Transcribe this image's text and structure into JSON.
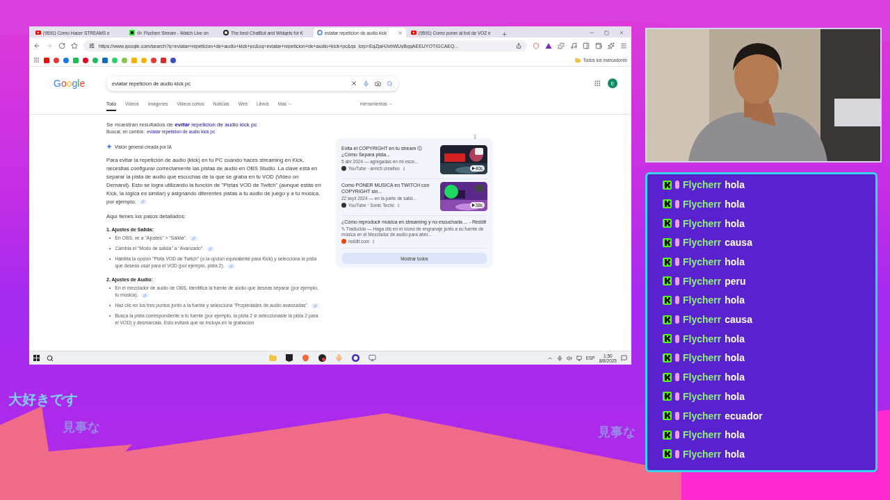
{
  "browser": {
    "tabs": [
      {
        "label": "(9591) Cómo Hacer STREAMS e",
        "kind": "youtube",
        "audio": false,
        "selected": false
      },
      {
        "label": "Flycherr Stream - Watch Live on",
        "kind": "kick",
        "audio": true,
        "selected": false
      },
      {
        "label": "The best ChatBot and Widgets for K",
        "kind": "bot",
        "audio": false,
        "selected": false
      },
      {
        "label": "eviatar repeticion de audio kick",
        "kind": "google",
        "audio": false,
        "selected": true
      },
      {
        "label": "(9591) Como poner al bot de VOZ e",
        "kind": "youtube",
        "audio": false,
        "selected": false
      }
    ],
    "address": "https://www.google.com/search?q=eviatar+repeticion+de+audio+kick+pc&oq=eviatar+repeticion+de+audio+kick+pc&gs_lcrp=EgZjaHJvbWUyBggAEEUYOTIGCAEQ...",
    "bookmarks_folder": "Todos los marcadores",
    "page": {
      "logo": "Google",
      "search": {
        "value": "eviatar repeticion de audio kick pc"
      },
      "avatar": "E",
      "filters": [
        {
          "label": "Todo",
          "selected": true
        },
        {
          "label": "Videos",
          "selected": false
        },
        {
          "label": "Imágenes",
          "selected": false
        },
        {
          "label": "Videos cortos",
          "selected": false
        },
        {
          "label": "Noticias",
          "selected": false
        },
        {
          "label": "Web",
          "selected": false
        },
        {
          "label": "Libros",
          "selected": false
        },
        {
          "label": "Más",
          "selected": false
        }
      ],
      "tools": "Herramientas",
      "correction": {
        "text": "Se muestran resultados de",
        "link": "**evitar** repeticion de audio kick pc"
      },
      "alternative": {
        "text": "Buscar, en cambio:",
        "link": "eviatar repeticion de audio kick pc"
      },
      "overview": {
        "label": "Visión general creada por IA",
        "intro": "Para evitar la repetición de audio (kick) en tu PC cuando haces streaming en Kick, necesitas configurar correctamente las pistas de audio en OBS Studio. La clave está en separar la pista de audio que escuchas de la que se graba en tu VOD (Video on Demand). Esto se logra utilizando la función de \"Pistas VOD de Twitch\" (aunque estás en Kick, la lógica es similar) y asignando diferentes pistas a tu audio de juego y a tu música, por ejemplo.",
        "steps_intro": "Aquí tienes los pasos detallados:",
        "bullet": "•",
        "sections": [
          {
            "heading": "1. Ajustes de Salida:",
            "bullets": [
              "En OBS, ve a \"Ajustes\" > \"Salida\".",
              "Cambia el \"Modo de salida\" a \"Avanzado\".",
              "Habilita la opción \"Pista VOD de Twitch\" (o la opción equivalente para Kick) y selecciona la pista que deseas usar para el VOD (por ejemplo, pista 2)."
            ]
          },
          {
            "heading": "2. Ajustes de Audio:",
            "bullets": [
              "En el mezclador de audio de OBS, identifica la fuente de audio que deseas separar (por ejemplo, tu música).",
              "Haz clic en los tres puntos junto a la fuente y selecciona \"Propiedades de audio avanzadas\".",
              "Busca la pista correspondiente a tu fuente (por ejemplo, la pista 2 si seleccionaste la pista 2 para el VOD) y desmárcala. Esto evitará que se incluya en la grabación"
            ]
          }
        ],
        "sources": [
          {
            "kind": "video",
            "title": "Evita el COPYRIGHT en tu stream Ⓒ ¿Cómo Separa pista...",
            "snippet": "5 abr 2024 — agregadas en mi esce...",
            "source": "YouTube · anrich creativo",
            "duration": "40s"
          },
          {
            "kind": "video",
            "title": "Como PONER MUSICA en TWITCH con COPYRIGHT sin...",
            "snippet": "22 sept 2024 — en la parte de salid...",
            "source": "YouTube · Sonic Techc",
            "duration": "38s"
          },
          {
            "kind": "article",
            "title": "¿Cómo reproducir música en streaming y no escucharla ... - Reddit",
            "snippet": "Traducido — Haga clic en el ícono de engranaje junto a su fuente de música en el Mezclador de audio para abrir...",
            "source": "reddit.com"
          }
        ],
        "show_all": "Mostrar todos"
      }
    },
    "taskbar": {
      "language": "ESP",
      "time": "1:50",
      "date": "8/8/2025"
    }
  },
  "overlay_texts": [
    "大好きです",
    "見事な",
    "見事な"
  ],
  "chat": [
    {
      "user": "Flycherr",
      "message": "hola"
    },
    {
      "user": "Flycherr",
      "message": "hola"
    },
    {
      "user": "Flycherr",
      "message": "hola"
    },
    {
      "user": "Flycherr",
      "message": "causa"
    },
    {
      "user": "Flycherr",
      "message": "hola"
    },
    {
      "user": "Flycherr",
      "message": "peru"
    },
    {
      "user": "Flycherr",
      "message": "hola"
    },
    {
      "user": "Flycherr",
      "message": "causa"
    },
    {
      "user": "Flycherr",
      "message": "hola"
    },
    {
      "user": "Flycherr",
      "message": "hola"
    },
    {
      "user": "Flycherr",
      "message": "hola"
    },
    {
      "user": "Flycherr",
      "message": "hola"
    },
    {
      "user": "Flycherr",
      "message": "ecuador"
    },
    {
      "user": "Flycherr",
      "message": "hola"
    },
    {
      "user": "Flycherr",
      "message": "hola"
    }
  ]
}
